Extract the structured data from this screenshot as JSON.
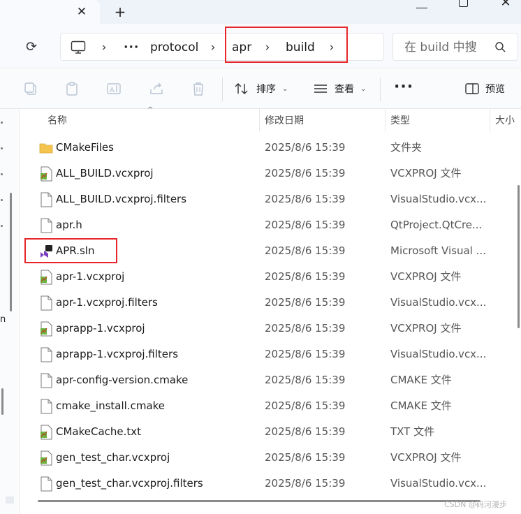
{
  "titlebar": {
    "close_tab": "✕",
    "new_tab": "+"
  },
  "address": {
    "crumbs": [
      "protocol",
      "apr",
      "build"
    ],
    "ellipsis": "···",
    "separator": "›",
    "search_placeholder": "在 build 中搜"
  },
  "toolbar": {
    "sort_label": "排序",
    "view_label": "查看",
    "more_label": "···",
    "preview_label": "预览"
  },
  "columns": {
    "name": "名称",
    "date": "修改日期",
    "type": "类型",
    "size": "大小"
  },
  "files": [
    {
      "name": "CMakeFiles",
      "date": "2025/8/6 15:39",
      "type": "文件夹",
      "icon": "folder-icon"
    },
    {
      "name": "ALL_BUILD.vcxproj",
      "date": "2025/8/6 15:39",
      "type": "VCXPROJ 文件",
      "icon": "vcxproj-file-icon"
    },
    {
      "name": "ALL_BUILD.vcxproj.filters",
      "date": "2025/8/6 15:39",
      "type": "VisualStudio.vcx...",
      "icon": "blank-file-icon"
    },
    {
      "name": "apr.h",
      "date": "2025/8/6 15:39",
      "type": "QtProject.QtCre...",
      "icon": "blank-file-icon"
    },
    {
      "name": "APR.sln",
      "date": "2025/8/6 15:39",
      "type": "Microsoft Visual ...",
      "icon": "visual-studio-sln-icon"
    },
    {
      "name": "apr-1.vcxproj",
      "date": "2025/8/6 15:39",
      "type": "VCXPROJ 文件",
      "icon": "vcxproj-file-icon"
    },
    {
      "name": "apr-1.vcxproj.filters",
      "date": "2025/8/6 15:39",
      "type": "VisualStudio.vcx...",
      "icon": "blank-file-icon"
    },
    {
      "name": "aprapp-1.vcxproj",
      "date": "2025/8/6 15:39",
      "type": "VCXPROJ 文件",
      "icon": "vcxproj-file-icon"
    },
    {
      "name": "aprapp-1.vcxproj.filters",
      "date": "2025/8/6 15:39",
      "type": "VisualStudio.vcx...",
      "icon": "blank-file-icon"
    },
    {
      "name": "apr-config-version.cmake",
      "date": "2025/8/6 15:39",
      "type": "CMAKE 文件",
      "icon": "blank-file-icon"
    },
    {
      "name": "cmake_install.cmake",
      "date": "2025/8/6 15:39",
      "type": "CMAKE 文件",
      "icon": "blank-file-icon"
    },
    {
      "name": "CMakeCache.txt",
      "date": "2025/8/6 15:39",
      "type": "TXT 文件",
      "icon": "vcxproj-file-icon"
    },
    {
      "name": "gen_test_char.vcxproj",
      "date": "2025/8/6 15:39",
      "type": "VCXPROJ 文件",
      "icon": "vcxproj-file-icon"
    },
    {
      "name": "gen_test_char.vcxproj.filters",
      "date": "2025/8/6 15:39",
      "type": "VisualStudio.vcx...",
      "icon": "blank-file-icon"
    }
  ],
  "nav": {
    "partial_letter": "n"
  },
  "watermark": "CSDN @码河漫步",
  "colors": {
    "highlight": "#e8252a",
    "folder": "#f4c44e",
    "vs_purple": "#7b3fbf"
  }
}
